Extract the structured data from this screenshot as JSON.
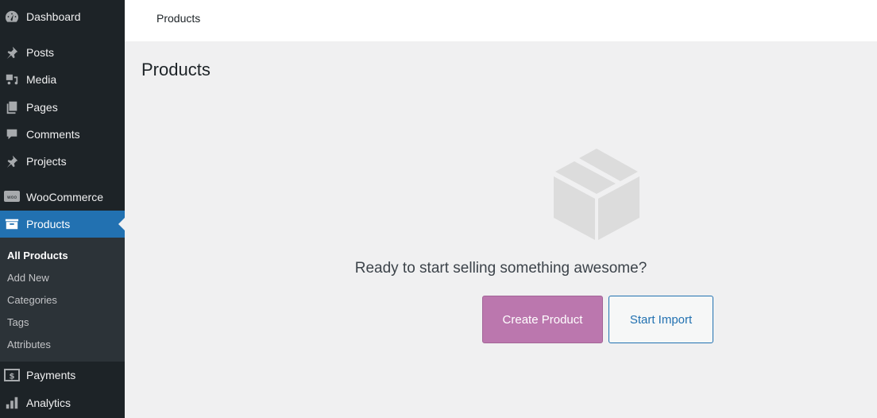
{
  "sidebar": {
    "items": [
      {
        "label": "Dashboard",
        "icon": "dashboard-icon"
      },
      {
        "label": "Posts",
        "icon": "pin-icon"
      },
      {
        "label": "Media",
        "icon": "media-icon"
      },
      {
        "label": "Pages",
        "icon": "pages-icon"
      },
      {
        "label": "Comments",
        "icon": "comment-icon"
      },
      {
        "label": "Projects",
        "icon": "pin-icon"
      },
      {
        "label": "WooCommerce",
        "icon": "woo-icon"
      },
      {
        "label": "Products",
        "icon": "archive-icon",
        "active": true
      },
      {
        "label": "Payments",
        "icon": "dollar-icon"
      },
      {
        "label": "Analytics",
        "icon": "bar-chart-icon"
      }
    ],
    "submenu": [
      {
        "label": "All Products",
        "current": true
      },
      {
        "label": "Add New"
      },
      {
        "label": "Categories"
      },
      {
        "label": "Tags"
      },
      {
        "label": "Attributes"
      }
    ]
  },
  "topbar": {
    "breadcrumb": "Products"
  },
  "page": {
    "title": "Products"
  },
  "empty_state": {
    "icon": "box-icon",
    "message": "Ready to start selling something awesome?",
    "primary_button": "Create Product",
    "secondary_button": "Start Import"
  },
  "colors": {
    "accent": "#2271b1",
    "woo_purple": "#bb77ae",
    "sidebar_bg": "#1d2327"
  }
}
